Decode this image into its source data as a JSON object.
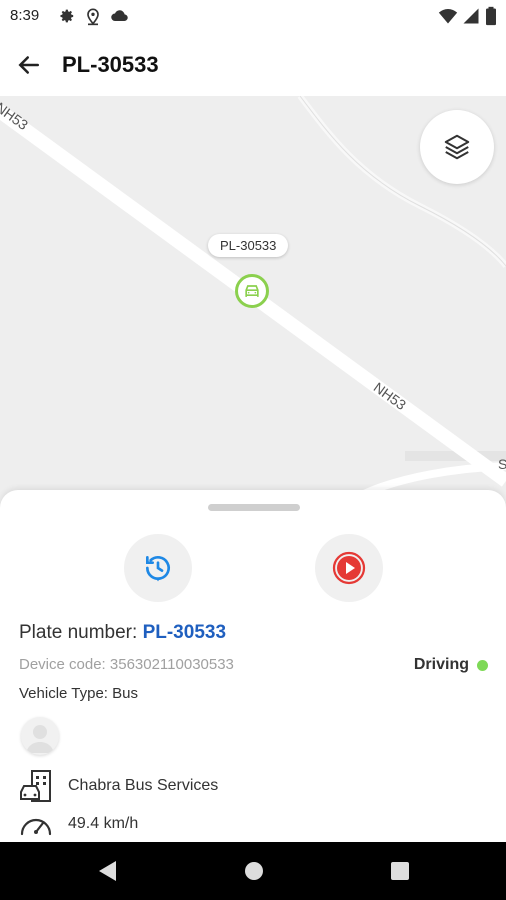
{
  "status_bar": {
    "time": "8:39",
    "icons": [
      "gear-icon",
      "location-pin-icon",
      "cloud-icon",
      "wifi-icon",
      "signal-icon",
      "battery-icon"
    ]
  },
  "app_bar": {
    "title": "PL-30533",
    "back_icon": "arrow-left-icon"
  },
  "map": {
    "vehicle_label": "PL-30533",
    "road_labels": [
      "NH53",
      "NH53",
      "S"
    ],
    "layers_icon": "layers-icon",
    "marker_color": "#8bd04e"
  },
  "sheet": {
    "history_icon": "history-icon",
    "playback_icon": "play-icon",
    "plate_label": "Plate number: ",
    "plate_value": "PL-30533",
    "device_code": "Device code: 356302110030533",
    "status": "Driving",
    "status_color": "#7ed957",
    "vehicle_type": "Vehicle Type: Bus",
    "company": "Chabra Bus Services",
    "speed": "49.4 km/h"
  },
  "nav_bar": {
    "icons": [
      "back-triangle-icon",
      "home-circle-icon",
      "recents-square-icon"
    ]
  }
}
